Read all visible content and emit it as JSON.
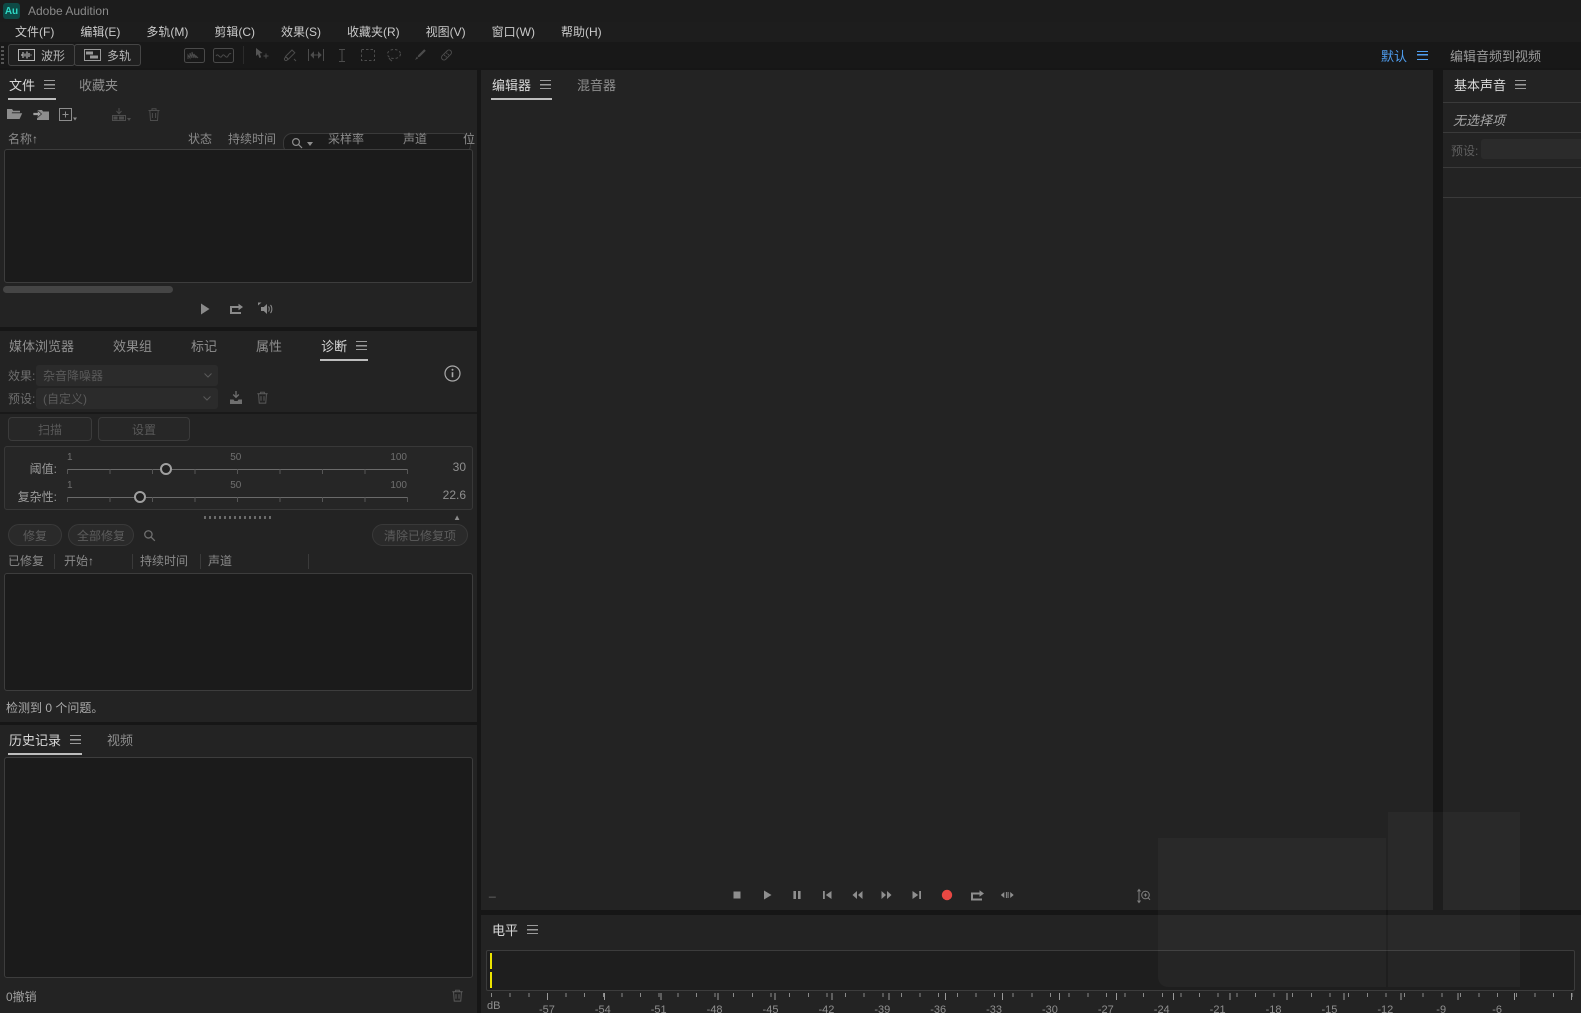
{
  "window": {
    "logo_text": "Au",
    "title": "Adobe Audition"
  },
  "menu_bar": {
    "items": [
      "文件(F)",
      "编辑(E)",
      "多轨(M)",
      "剪辑(C)",
      "效果(S)",
      "收藏夹(R)",
      "视图(V)",
      "窗口(W)",
      "帮助(H)"
    ]
  },
  "toolbar": {
    "waveform_label": "波形",
    "multitrack_label": "多轨",
    "view_icons": [
      "waveform-view-icon",
      "spectral-view-icon"
    ],
    "tool_icons": [
      "move-tool-icon",
      "razor-tool-icon",
      "slip-tool-icon",
      "time-selection-tool-icon",
      "marquee-selection-tool-icon",
      "lasso-selection-tool-icon",
      "paintbrush-tool-icon",
      "spot-healing-brush-tool-icon"
    ],
    "workspace_label": "默认",
    "workspace_extra_label": "编辑音频到视频"
  },
  "files_panel": {
    "tabs": [
      {
        "label": "文件",
        "active": true
      },
      {
        "label": "收藏夹",
        "active": false
      }
    ],
    "toolbar_icons": [
      "open-file-icon",
      "import-file-icon",
      "new-item-icon",
      "insert-into-multitrack-icon",
      "trash-icon",
      "search-icon"
    ],
    "search_value": "",
    "sort_arrow": "↑",
    "columns": [
      "名称",
      "状态",
      "持续时间",
      "采样率",
      "声道",
      "位"
    ],
    "rows": [],
    "footer_icons": [
      "play-icon",
      "loop-icon",
      "auto-play-speaker-icon"
    ]
  },
  "diagnostics_panel": {
    "tabs": [
      {
        "label": "媒体浏览器",
        "active": false
      },
      {
        "label": "效果组",
        "active": false
      },
      {
        "label": "标记",
        "active": false
      },
      {
        "label": "属性",
        "active": false
      },
      {
        "label": "诊断",
        "active": true
      }
    ],
    "effect_label": "效果:",
    "effect_value": "杂音降噪器",
    "preset_label": "预设:",
    "preset_value": "(自定义)",
    "scan_button": "扫描",
    "settings_button": "设置",
    "sliders": [
      {
        "label": "阈值:",
        "min": "1",
        "mid": "50",
        "max": "100",
        "value": "30",
        "percent": 29.3
      },
      {
        "label": "复杂性:",
        "min": "1",
        "mid": "50",
        "max": "100",
        "value": "22.6",
        "percent": 21.8
      }
    ],
    "fix_button": "修复",
    "fix_all_button": "全部修复",
    "clear_button": "清除已修复项",
    "table_columns": [
      "已修复",
      "开始",
      "持续时间",
      "声道"
    ],
    "sort_arrow": "↑",
    "issues": [],
    "status": "检测到 0 个问题。"
  },
  "history_panel": {
    "tabs": [
      {
        "label": "历史记录",
        "active": true
      },
      {
        "label": "视频",
        "active": false
      }
    ],
    "entries": [],
    "undo_status": "0撤销"
  },
  "editor_panel": {
    "tabs": [
      {
        "label": "编辑器",
        "active": true
      },
      {
        "label": "混音器",
        "active": false
      }
    ],
    "time_placeholder": "_",
    "transport_icons": [
      "stop-icon",
      "play-icon",
      "pause-icon",
      "skip-to-start-icon",
      "rewind-icon",
      "fast-forward-icon",
      "skip-to-end-icon",
      "record-icon",
      "loop-playback-icon",
      "skip-selection-icon"
    ],
    "zoom_icon": "vertical-zoom-icon"
  },
  "levels_panel": {
    "title": "电平",
    "unit_label": "dB",
    "scale": [
      -57,
      -54,
      -51,
      -48,
      -45,
      -42,
      -39,
      -36,
      -33,
      -30,
      -27,
      -24,
      -21,
      -18,
      -15,
      -12,
      -9,
      -6
    ]
  },
  "essential_sound_panel": {
    "title": "基本声音",
    "no_selection": "无选择项",
    "preset_label": "预设:",
    "preset_value": ""
  },
  "colors": {
    "accent_blue": "#4f9ef0",
    "record_red": "#e84843",
    "meter_yellow": "#ece400",
    "logo_teal": "#2fd9c5"
  }
}
